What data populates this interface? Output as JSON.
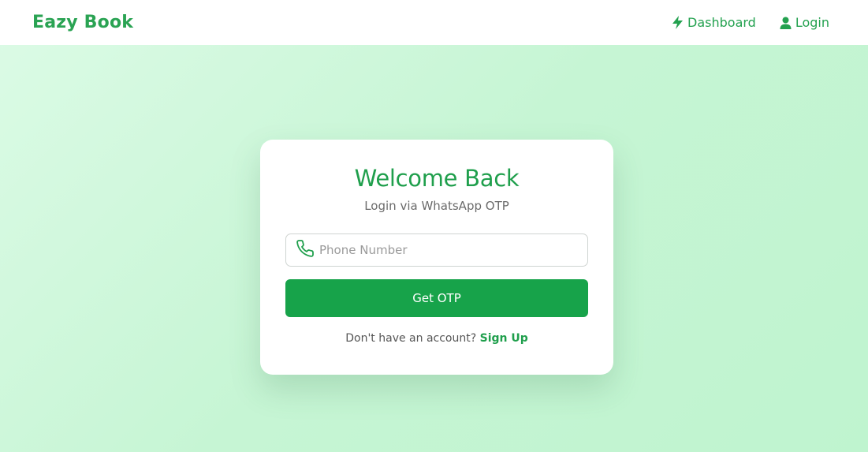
{
  "navbar": {
    "brand": "Eazy Book",
    "links": [
      {
        "label": "Dashboard",
        "icon": "bolt-icon"
      },
      {
        "label": "Login",
        "icon": "user-icon"
      }
    ]
  },
  "login_card": {
    "title": "Welcome Back",
    "subtitle": "Login via WhatsApp OTP",
    "phone_placeholder": "Phone Number",
    "phone_value": "",
    "submit_label": "Get OTP",
    "signup_prompt": "Don't have an account?",
    "signup_link": "Sign Up"
  },
  "colors": {
    "accent": "#17a34a",
    "brand_text": "#2aa353",
    "background_start": "#dcfbe6",
    "background_end": "#bff4cf"
  }
}
